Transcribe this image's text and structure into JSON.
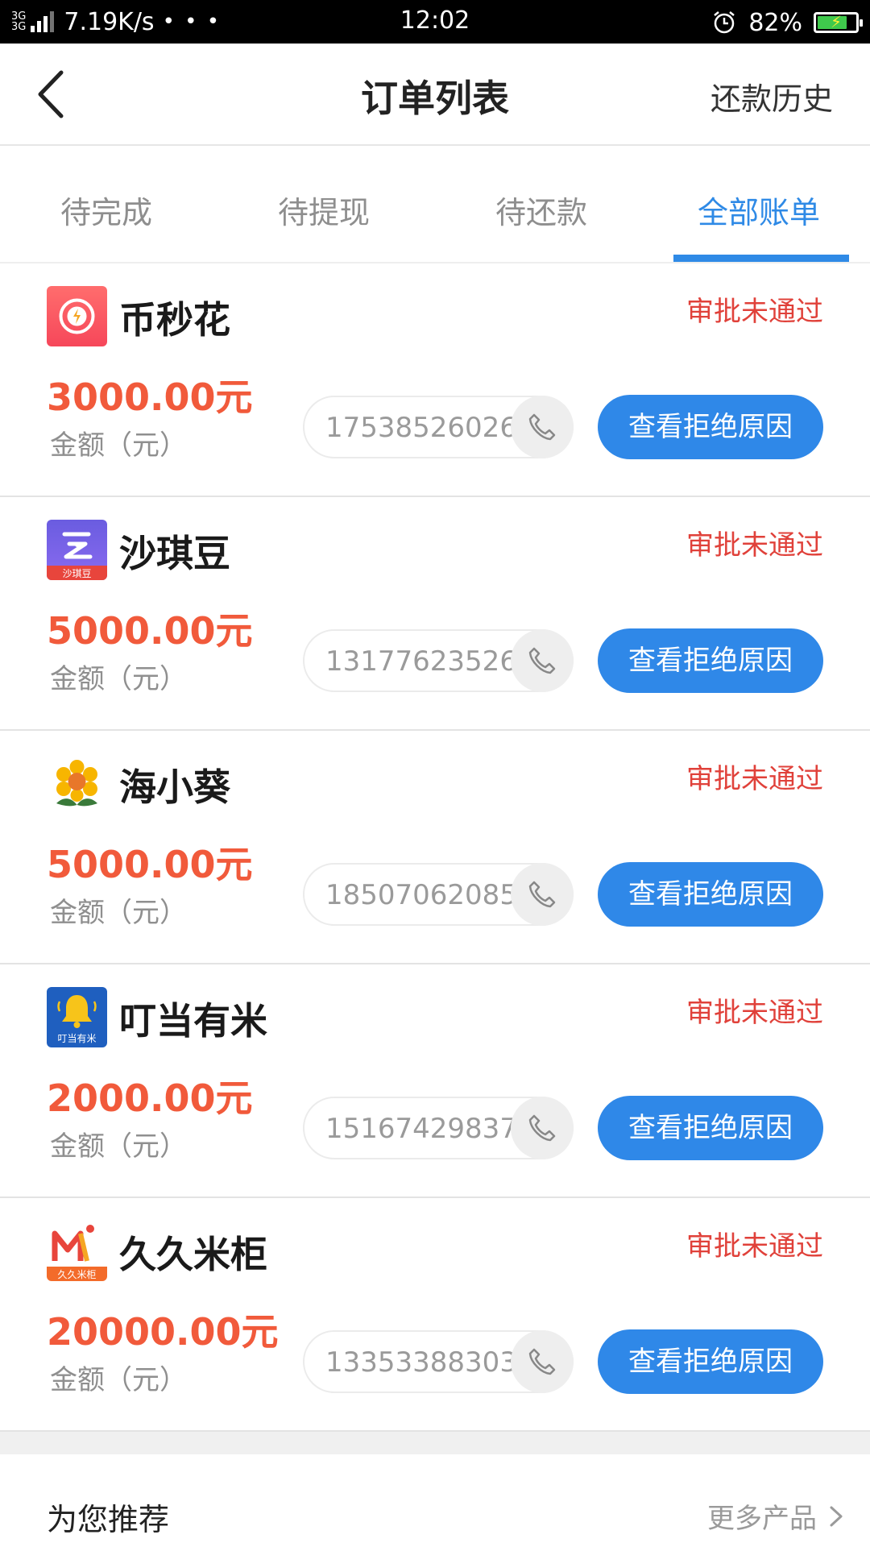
{
  "status_bar": {
    "network": "3G",
    "network2": "3G",
    "speed": "7.19K/s",
    "dots": "• • •",
    "time": "12:02",
    "battery": "82%",
    "battery_level": 0.82,
    "icons": [
      "signal-icon",
      "alarm-icon",
      "battery-icon"
    ]
  },
  "header": {
    "back_icon": "chevron-left-icon",
    "title": "订单列表",
    "right_link": "还款历史"
  },
  "tabs": [
    {
      "label": "待完成",
      "active": false
    },
    {
      "label": "待提现",
      "active": false
    },
    {
      "label": "待还款",
      "active": false
    },
    {
      "label": "全部账单",
      "active": true
    }
  ],
  "orders": [
    {
      "name": "币秒花",
      "status": "审批未通过",
      "amount": "3000.00元",
      "amount_label": "金额（元）",
      "phone": "17538526026",
      "button": "查看拒绝原因",
      "logo": "bimiaohua-logo"
    },
    {
      "name": "沙琪豆",
      "status": "审批未通过",
      "amount": "5000.00元",
      "amount_label": "金额（元）",
      "phone": "13177623526",
      "button": "查看拒绝原因",
      "logo": "shaqidou-logo",
      "logo_text": "沙琪豆"
    },
    {
      "name": "海小葵",
      "status": "审批未通过",
      "amount": "5000.00元",
      "amount_label": "金额（元）",
      "phone": "18507062085",
      "button": "查看拒绝原因",
      "logo": "sunflower-logo"
    },
    {
      "name": "叮当有米",
      "status": "审批未通过",
      "amount": "2000.00元",
      "amount_label": "金额（元）",
      "phone": "15167429837",
      "button": "查看拒绝原因",
      "logo": "bell-logo",
      "logo_text": "叮当有米"
    },
    {
      "name": "久久米柜",
      "status": "审批未通过",
      "amount": "20000.00元",
      "amount_label": "金额（元）",
      "phone": "13353388303",
      "button": "查看拒绝原因",
      "logo": "jiujiumigui-logo",
      "logo_text": "久久米柜"
    }
  ],
  "recommend": {
    "title": "为您推荐",
    "more": "更多产品"
  },
  "colors": {
    "accent": "#2f88e8",
    "status_red": "#e0413a",
    "amount_orange": "#f15a3b"
  }
}
